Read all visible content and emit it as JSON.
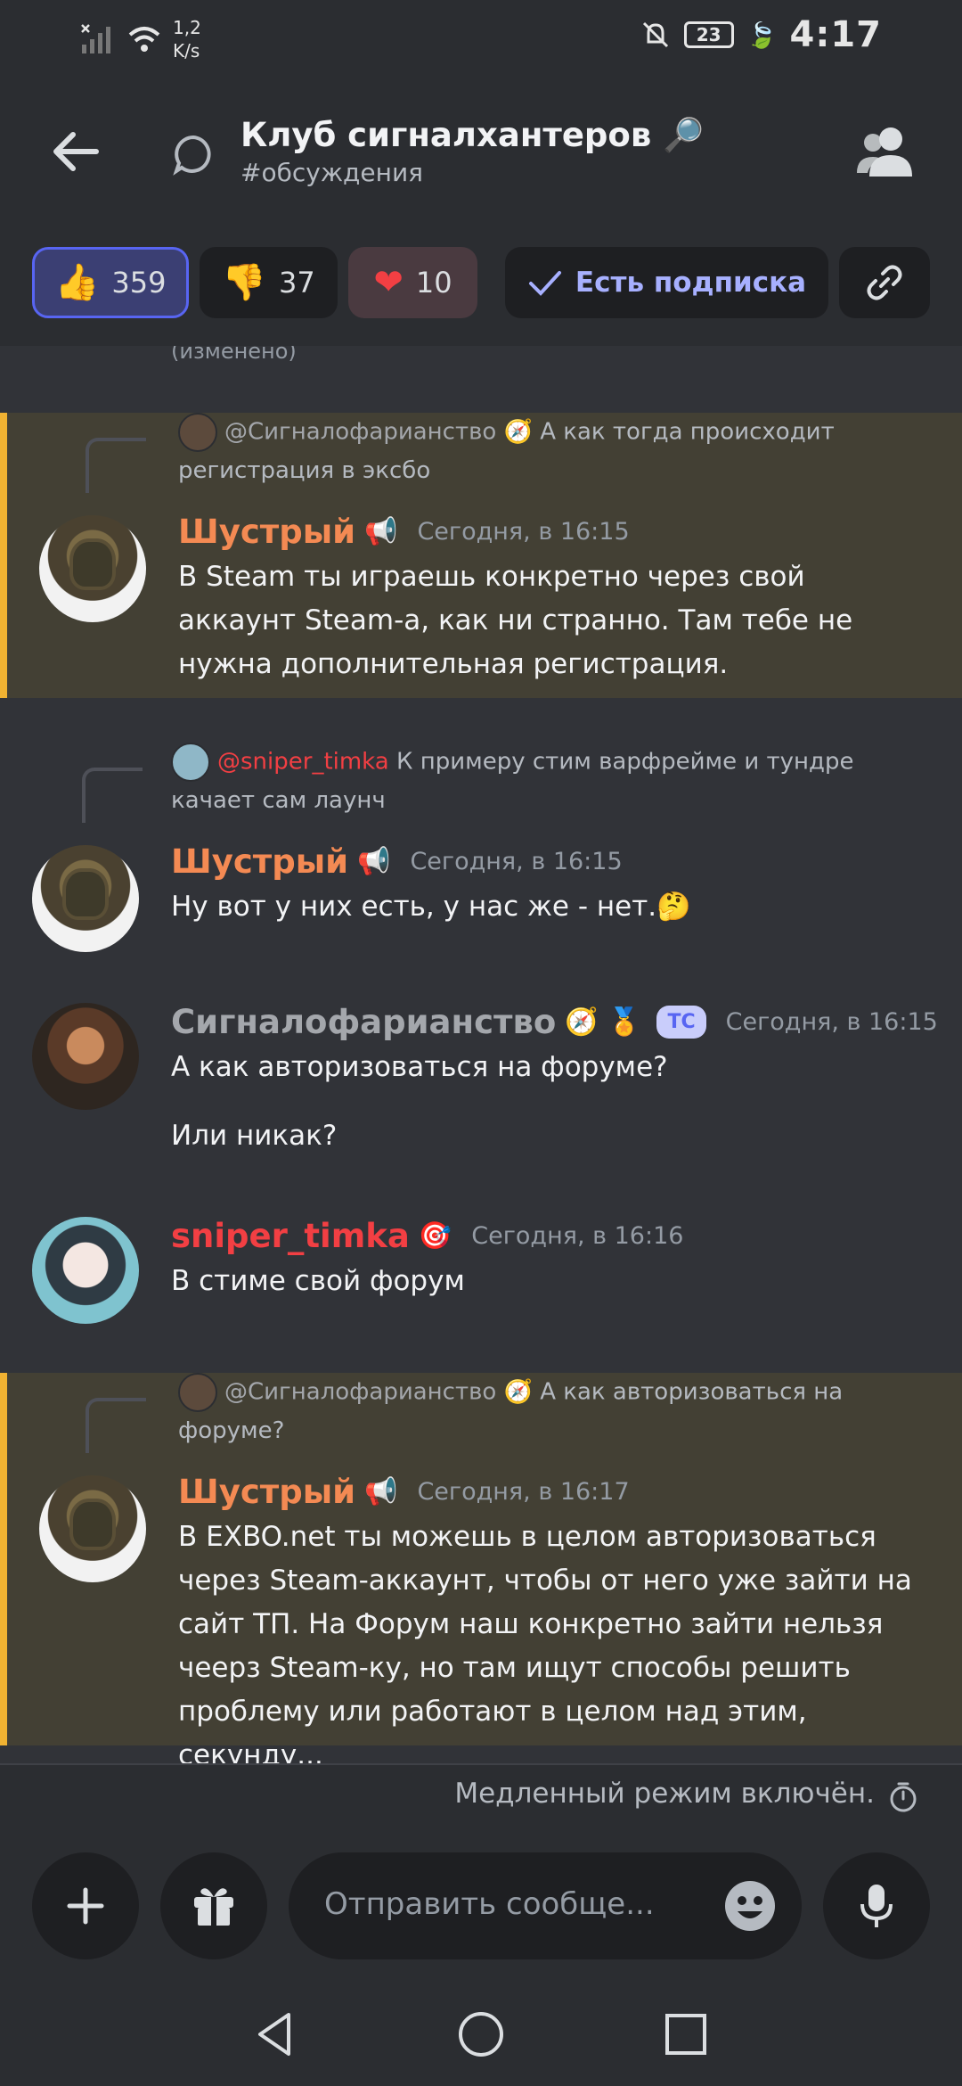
{
  "status_bar": {
    "net_speed": "1,2\nK/s",
    "battery": "23",
    "time": "4:17"
  },
  "header": {
    "title": "Клуб сигналхантеров 🔎",
    "subtitle": "#обсуждения"
  },
  "reactions": [
    {
      "emoji": "👍",
      "count": "359"
    },
    {
      "emoji": "👎",
      "count": "37"
    },
    {
      "emoji": "❤",
      "count": "10"
    }
  ],
  "follow_label": "Есть подписка",
  "chat": {
    "edited_label": "(изменено)",
    "messages": [
      {
        "reply_name": "@Сигналофарианство 🧭",
        "reply_text": " А как тогда происходит регистрация в эксбо",
        "author": "Шустрый",
        "author_tag": "📢",
        "time": "Сегодня, в 16:15",
        "text": "В Steam ты играешь конкретно через свой аккаунт Steam-а, как ни странно. Там тебе не нужна дополнительная регистрация."
      },
      {
        "reply_name": "@sniper_timka",
        "reply_text": " К примеру стим варфрейме и тундре качает сам лаунч",
        "author": "Шустрый",
        "author_tag": "📢",
        "time": "Сегодня, в 16:15",
        "text": "Ну вот у них есть, у нас же - нет.🤔"
      },
      {
        "author": "Сигналофарианство",
        "author_tag": "🧭 🏅",
        "badge": "TC",
        "time": "Сегодня, в 16:15",
        "text": "А как авторизоваться на форуме?",
        "text2": "Или никак?"
      },
      {
        "author": "sniper_timka",
        "author_tag": "🎯",
        "time": "Сегодня, в 16:16",
        "text": "В стиме свой форум"
      },
      {
        "reply_name": "@Сигналофарианство 🧭",
        "reply_text": " А как авторизоваться на форуме?",
        "author": "Шустрый",
        "author_tag": "📢",
        "time": "Сегодня, в 16:17",
        "text": "В EXBO.net ты можешь в целом авторизоваться через Steam-аккаунт, чтобы от него уже зайти на сайт ТП. На Форум наш конкретно зайти нельзя чеерз Steam-ку, но там ищут способы решить проблему или работают в целом над этим, секунду..."
      }
    ]
  },
  "slow_mode": "Медленный режим включён.",
  "composer": {
    "placeholder": "Отправить сообще..."
  },
  "colors": {
    "accent": "#5865f2",
    "highlight": "#f0b232",
    "name_orange": "#f48a53",
    "name_red": "#f23f43"
  }
}
